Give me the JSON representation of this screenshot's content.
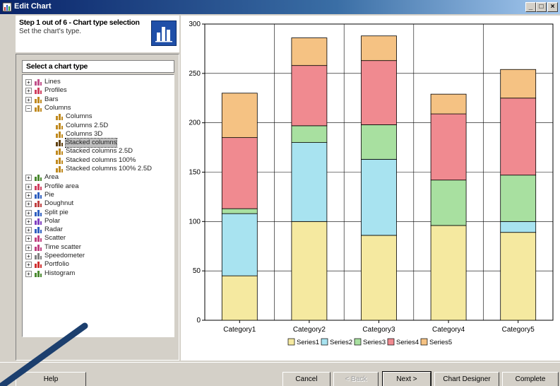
{
  "window": {
    "title": "Edit Chart",
    "buttons": {
      "minimize": "_",
      "maximize": "□",
      "close": "×"
    }
  },
  "step": {
    "title": "Step 1 out of 6 - Chart type selection",
    "description": "Set the chart's type."
  },
  "tree": {
    "header": "Select a chart type",
    "items": [
      {
        "label": "Lines",
        "level": 0,
        "expander": "+",
        "icon": "lines-icon",
        "color": "#c0508a"
      },
      {
        "label": "Profiles",
        "level": 0,
        "expander": "+",
        "icon": "profiles-icon",
        "color": "#d04060"
      },
      {
        "label": "Bars",
        "level": 0,
        "expander": "+",
        "icon": "bars-icon",
        "color": "#c08a20"
      },
      {
        "label": "Columns",
        "level": 0,
        "expander": "−",
        "icon": "columns-icon",
        "color": "#c08a20"
      },
      {
        "label": "Columns",
        "level": 1,
        "icon": "columns-icon",
        "color": "#c08a20"
      },
      {
        "label": "Columns 2.5D",
        "level": 1,
        "icon": "columns-icon",
        "color": "#c08a20"
      },
      {
        "label": "Columns 3D",
        "level": 1,
        "icon": "columns-icon",
        "color": "#c08a20"
      },
      {
        "label": "Stacked columns",
        "level": 1,
        "icon": "stacked-columns-icon",
        "color": "#604010",
        "selected": true
      },
      {
        "label": "Stacked columns 2.5D",
        "level": 1,
        "icon": "columns-icon",
        "color": "#c08a20"
      },
      {
        "label": "Stacked columns 100%",
        "level": 1,
        "icon": "columns-icon",
        "color": "#c08a20"
      },
      {
        "label": "Stacked columns 100% 2.5D",
        "level": 1,
        "icon": "columns-icon",
        "color": "#c08a20"
      },
      {
        "label": "Area",
        "level": 0,
        "expander": "+",
        "icon": "area-icon",
        "color": "#4a8a30"
      },
      {
        "label": "Profile area",
        "level": 0,
        "expander": "+",
        "icon": "profile-area-icon",
        "color": "#d04060"
      },
      {
        "label": "Pie",
        "level": 0,
        "expander": "+",
        "icon": "pie-icon",
        "color": "#3060c0"
      },
      {
        "label": "Doughnut",
        "level": 0,
        "expander": "+",
        "icon": "doughnut-icon",
        "color": "#c04040"
      },
      {
        "label": "Split pie",
        "level": 0,
        "expander": "+",
        "icon": "split-pie-icon",
        "color": "#3060c0"
      },
      {
        "label": "Polar",
        "level": 0,
        "expander": "+",
        "icon": "polar-icon",
        "color": "#8040c0"
      },
      {
        "label": "Radar",
        "level": 0,
        "expander": "+",
        "icon": "radar-icon",
        "color": "#3060c0"
      },
      {
        "label": "Scatter",
        "level": 0,
        "expander": "+",
        "icon": "scatter-icon",
        "color": "#c04080"
      },
      {
        "label": "Time scatter",
        "level": 0,
        "expander": "+",
        "icon": "time-scatter-icon",
        "color": "#c04080"
      },
      {
        "label": "Speedometer",
        "level": 0,
        "expander": "+",
        "icon": "speedometer-icon",
        "color": "#808080"
      },
      {
        "label": "Portfolio",
        "level": 0,
        "expander": "+",
        "icon": "portfolio-icon",
        "color": "#d03030"
      },
      {
        "label": "Histogram",
        "level": 0,
        "expander": "+",
        "icon": "histogram-icon",
        "color": "#4a8a30"
      }
    ]
  },
  "buttons": {
    "help": "Help",
    "cancel": "Cancel",
    "back": "< Back",
    "next": "Next >",
    "designer": "Chart Designer",
    "complete": "Complete"
  },
  "colors": {
    "window_blue": "#0a246a",
    "selection": "#c0c0c0",
    "pen_stroke": "#1c3f6e"
  },
  "chart_data": {
    "type": "bar",
    "stacked": true,
    "categories": [
      "Category1",
      "Category2",
      "Category3",
      "Category4",
      "Category5"
    ],
    "series": [
      {
        "name": "Series1",
        "color": "#f5e9a0",
        "values": [
          45,
          100,
          86,
          96,
          89
        ]
      },
      {
        "name": "Series2",
        "color": "#a8e3f0",
        "values": [
          63,
          80,
          77,
          0,
          11
        ]
      },
      {
        "name": "Series3",
        "color": "#a8e0a0",
        "values": [
          5,
          17,
          35,
          46,
          47
        ]
      },
      {
        "name": "Series4",
        "color": "#f08a90",
        "values": [
          72,
          61,
          65,
          67,
          78
        ]
      },
      {
        "name": "Series5",
        "color": "#f5c283",
        "values": [
          45,
          28,
          25,
          20,
          29
        ]
      }
    ],
    "yticks": [
      "0",
      "50",
      "100",
      "150",
      "200",
      "250",
      "300"
    ],
    "ylim": [
      0,
      300
    ],
    "grid": true,
    "legend": "bottom"
  }
}
